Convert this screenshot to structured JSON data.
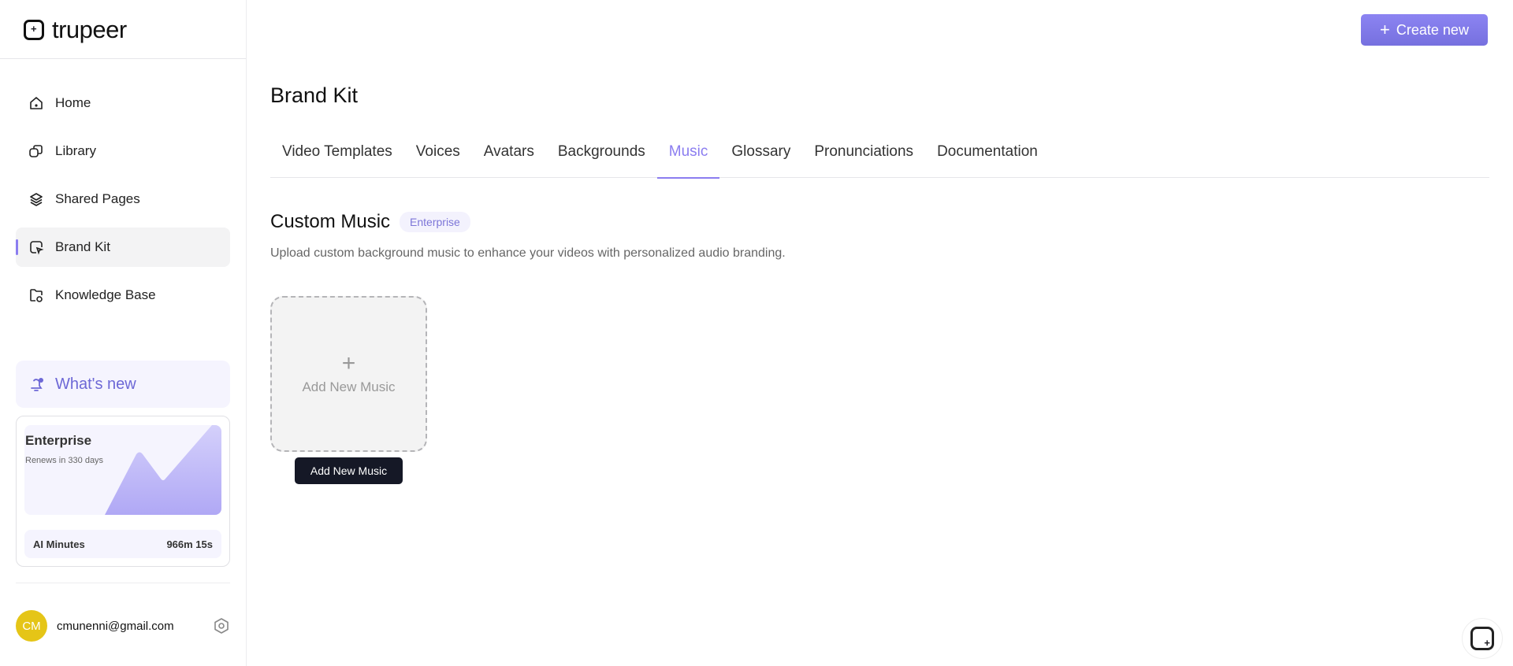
{
  "app": {
    "logo_text": "trupeer"
  },
  "sidebar": {
    "items": [
      {
        "label": "Home"
      },
      {
        "label": "Library"
      },
      {
        "label": "Shared Pages"
      },
      {
        "label": "Brand Kit"
      },
      {
        "label": "Knowledge Base"
      }
    ],
    "whats_new": "What's new",
    "plan": {
      "name": "Enterprise",
      "renews": "Renews in 330 days",
      "minutes_label": "AI Minutes",
      "minutes_value": "966m 15s"
    },
    "user": {
      "initials": "CM",
      "email": "cmunenni@gmail.com",
      "avatar_color": "#e5c517"
    }
  },
  "header": {
    "create_label": "Create new",
    "accent": "#8b7df0"
  },
  "main": {
    "title": "Brand Kit",
    "tabs": [
      {
        "label": "Video Templates"
      },
      {
        "label": "Voices"
      },
      {
        "label": "Avatars"
      },
      {
        "label": "Backgrounds"
      },
      {
        "label": "Music"
      },
      {
        "label": "Glossary"
      },
      {
        "label": "Pronunciations"
      },
      {
        "label": "Documentation"
      }
    ],
    "active_tab": "Music",
    "section_title": "Custom Music",
    "section_badge": "Enterprise",
    "description": "Upload custom background music to enhance your videos with personalized audio branding.",
    "add_card": {
      "plus": "+",
      "label": "Add New Music"
    },
    "tooltip": "Add New Music"
  }
}
